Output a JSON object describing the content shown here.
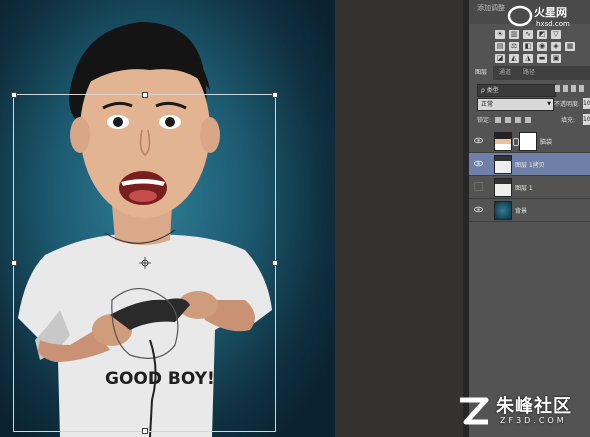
{
  "panel": {
    "header_text": "添加调整",
    "tabs": [
      "图层",
      "通道",
      "路径"
    ],
    "filter_label": "ρ 类型",
    "blend_mode": "正常",
    "opacity_label": "不透明度:",
    "opacity_value": "10",
    "lock_label": "锁定:",
    "fill_label": "填充:",
    "fill_value": "10",
    "layers": [
      {
        "name": "脑袋",
        "visible": true,
        "selected": false
      },
      {
        "name": "图层 1拷贝",
        "visible": true,
        "selected": true
      },
      {
        "name": "图层 1",
        "visible": false,
        "selected": false
      },
      {
        "name": "背景",
        "visible": true,
        "selected": false
      }
    ]
  },
  "canvas": {
    "shirt_text": "GOOD BOY!"
  },
  "watermarks": {
    "top_cn": "火星网",
    "top_en": "hxsd.com",
    "bottom_cn": "朱峰社区",
    "bottom_en": "ZF3D.COM"
  },
  "colors": {
    "canvas_teal": "#1d5a70",
    "panel_gray": "#535353",
    "selected_layer": "#6f80a8"
  }
}
